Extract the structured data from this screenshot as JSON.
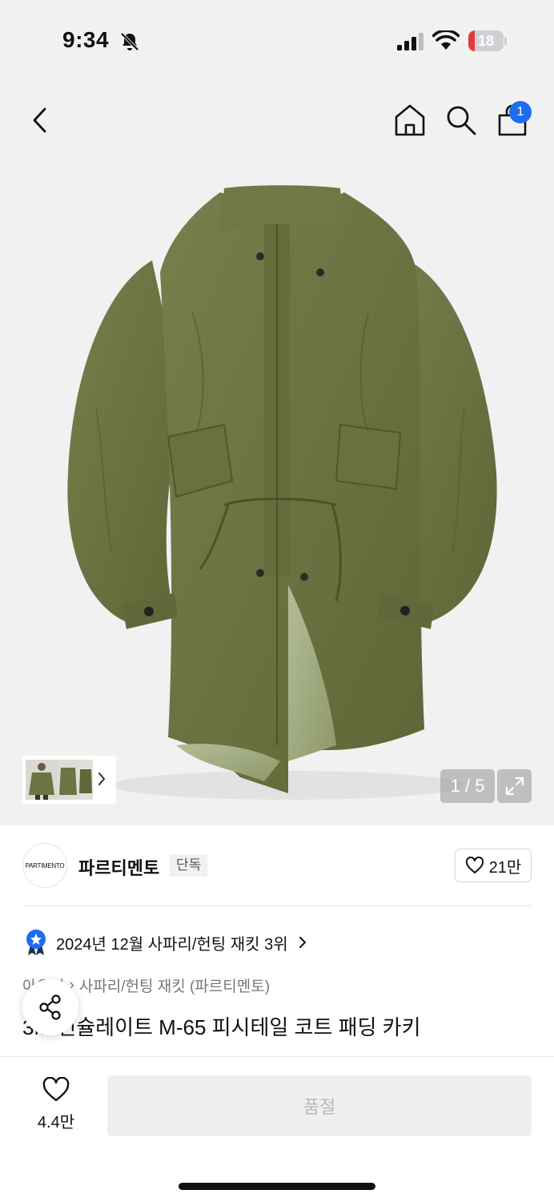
{
  "status_bar": {
    "time": "9:34",
    "battery_level": "18",
    "battery_fraction": 0.18,
    "icons": [
      "bell-slash-icon",
      "signal-icon",
      "wifi-icon",
      "battery-charging-icon"
    ]
  },
  "nav": {
    "cart_badge": "1",
    "icons": [
      "back-chevron-icon",
      "home-icon",
      "search-icon",
      "shopping-bag-icon"
    ]
  },
  "gallery": {
    "current": "1",
    "total": "5",
    "separator": "/",
    "expand_icon": "expand-icon"
  },
  "brand": {
    "logo_text": "PARTIMENTO",
    "name": "파르티멘토",
    "badge": "단독",
    "like_count": "21만"
  },
  "ranking": {
    "text": "2024년 12월 사파리/헌팅 재킷 3위"
  },
  "breadcrumb": {
    "items": [
      "아우터",
      "사파리/헌팅 재킷 (파르티멘토)"
    ],
    "visible_first": "아우터"
  },
  "product": {
    "title": "3M 신슐레이트 M-65 피시테일 코트 패딩 카키"
  },
  "bottom_bar": {
    "wish_count": "4.4만",
    "buy_label": "품절"
  },
  "colors": {
    "accent_blue": "#1e6cf0",
    "battery_red": "#e4393c",
    "coat_khaki": "#6b7442",
    "disabled_text": "#b9b9bd"
  }
}
